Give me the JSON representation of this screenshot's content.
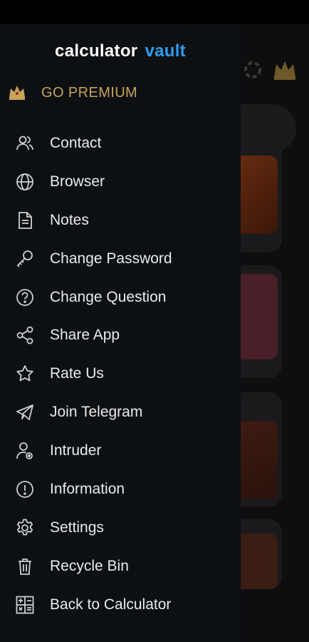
{
  "app": {
    "brand_part1": "calculator",
    "brand_part2": "vault",
    "accent": "#2f9cf0",
    "premium_color": "#c8a35a"
  },
  "premium": {
    "label": "GO PREMIUM",
    "icon": "crown-icon"
  },
  "menu": [
    {
      "label": "Contact",
      "icon": "contacts-icon"
    },
    {
      "label": "Browser",
      "icon": "globe-icon"
    },
    {
      "label": "Notes",
      "icon": "note-icon"
    },
    {
      "label": "Change Password",
      "icon": "key-icon"
    },
    {
      "label": "Change Question",
      "icon": "question-icon"
    },
    {
      "label": "Share App",
      "icon": "share-icon"
    },
    {
      "label": "Rate Us",
      "icon": "star-icon"
    },
    {
      "label": "Join Telegram",
      "icon": "telegram-icon"
    },
    {
      "label": "Intruder",
      "icon": "intruder-icon"
    },
    {
      "label": "Information",
      "icon": "info-icon"
    },
    {
      "label": "Settings",
      "icon": "gear-icon"
    },
    {
      "label": "Recycle Bin",
      "icon": "trash-icon"
    },
    {
      "label": "Back to Calculator",
      "icon": "calculator-icon"
    }
  ]
}
